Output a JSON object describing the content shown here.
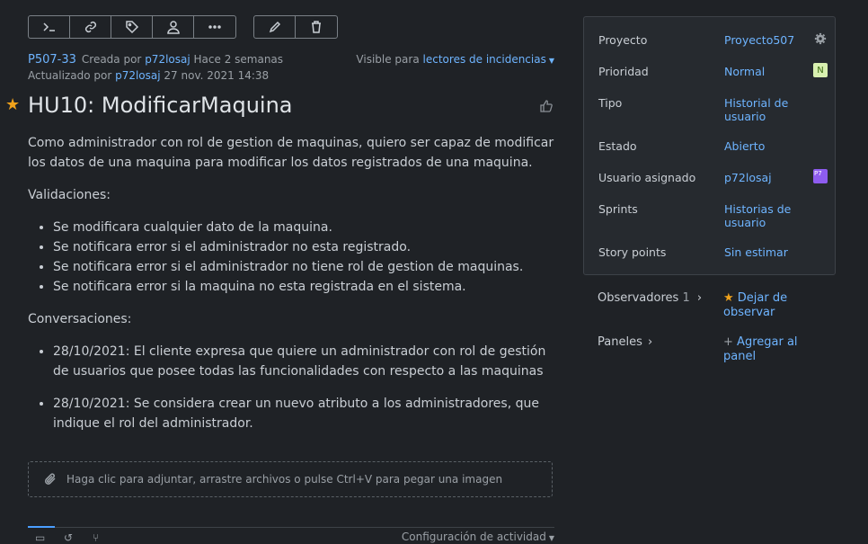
{
  "toolbar": {
    "buttons": [
      {
        "name": "terminal-icon"
      },
      {
        "name": "link-icon"
      },
      {
        "name": "tag-icon"
      },
      {
        "name": "user-icon"
      },
      {
        "name": "more-icon"
      }
    ],
    "edit_buttons": [
      {
        "name": "pencil-icon"
      },
      {
        "name": "trash-icon"
      }
    ]
  },
  "issue": {
    "key": "P507-33",
    "created_prefix": "Creada por",
    "created_user": "p72losaj",
    "created_when": "Hace 2 semanas",
    "updated_prefix": "Actualizado por",
    "updated_user": "p72losaj",
    "updated_when": "27 nov. 2021 14:38",
    "visible_prefix": "Visible para",
    "visible_link": "lectores de incidencias",
    "title": "HU10: ModificarMaquina"
  },
  "description": {
    "intro": "Como administrador con rol de gestion de maquinas, quiero ser capaz de modificar los datos de una maquina para modificar los datos registrados de una maquina.",
    "validations_heading": "Validaciones:",
    "validations": [
      "Se modificara cualquier dato de la maquina.",
      "Se notificara error si el administrador no esta registrado.",
      "Se notificara error si el administrador no tiene rol de gestion de maquinas.",
      "Se notificara error si la maquina no esta registrada en el sistema."
    ],
    "conversations_heading": "Conversaciones:",
    "conversations": [
      "28/10/2021: El cliente expresa que quiere un administrador con rol de gestión de usuarios que posee todas las funcionalidades con respecto a las maquinas",
      "28/10/2021: Se considera crear un nuevo atributo a los administradores, que indique el rol del administrador."
    ]
  },
  "attach": {
    "text": "Haga clic para adjuntar, arrastre archivos o pulse Ctrl+V para pegar una imagen"
  },
  "activity": {
    "config_label": "Configuración de actividad"
  },
  "panel": {
    "rows": [
      {
        "label": "Proyecto",
        "value": "Proyecto507"
      },
      {
        "label": "Prioridad",
        "value": "Normal",
        "badge": "N"
      },
      {
        "label": "Tipo",
        "value": "Historial de usuario"
      },
      {
        "label": "Estado",
        "value": "Abierto"
      },
      {
        "label": "Usuario asignado",
        "value": "p72losaj",
        "badge": "P7"
      },
      {
        "label": "Sprints",
        "value": "Historias de usuario"
      },
      {
        "label": "Story points",
        "value": "Sin estimar"
      }
    ]
  },
  "side": {
    "watchers_label": "Observadores",
    "watchers_count": "1",
    "unwatch_label": "Dejar de observar",
    "boards_label": "Paneles",
    "add_board_label": "Agregar al panel"
  },
  "colors": {
    "background": "#1f2226",
    "accent": "#6eb4ff",
    "star": "#f0a21b",
    "priority_badge": "#d8f0b0",
    "avatar_badge": "#8e5cf0"
  }
}
